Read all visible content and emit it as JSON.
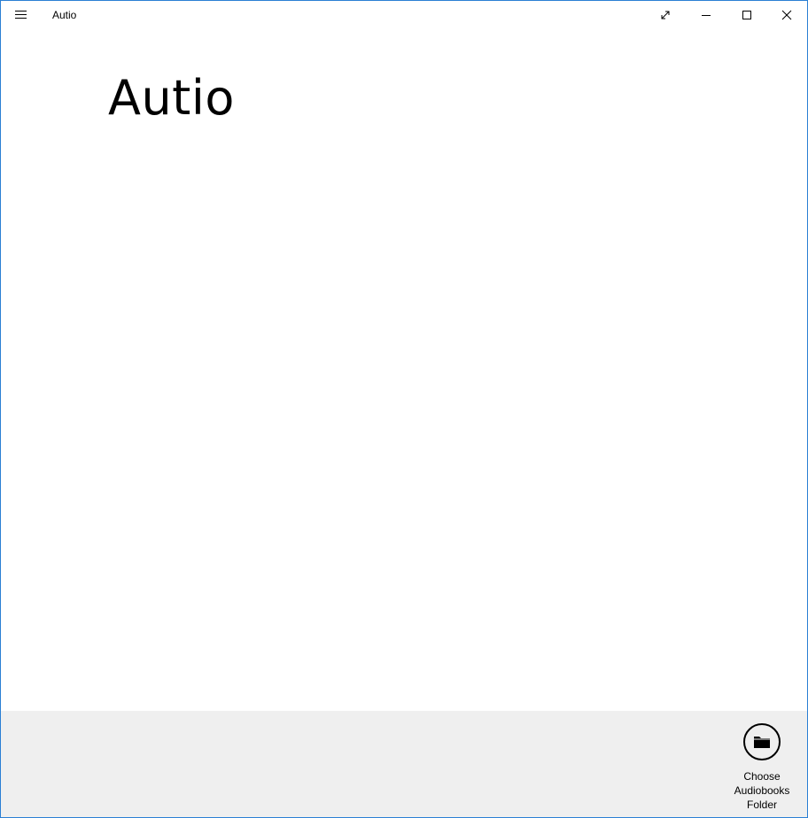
{
  "window": {
    "title": "Autio",
    "accent_color": "#2b7fd4"
  },
  "titlebar": {
    "menu_icon": "hamburger-icon",
    "buttons": {
      "fullscreen_icon": "fullscreen-icon",
      "minimize_icon": "minimize-icon",
      "maximize_icon": "maximize-icon",
      "close_icon": "close-icon"
    }
  },
  "main": {
    "page_title": "Autio"
  },
  "appbar": {
    "background": "#efefef",
    "choose_folder": {
      "icon": "folder-icon",
      "label": "Choose\nAudiobooks\nFolder"
    }
  }
}
